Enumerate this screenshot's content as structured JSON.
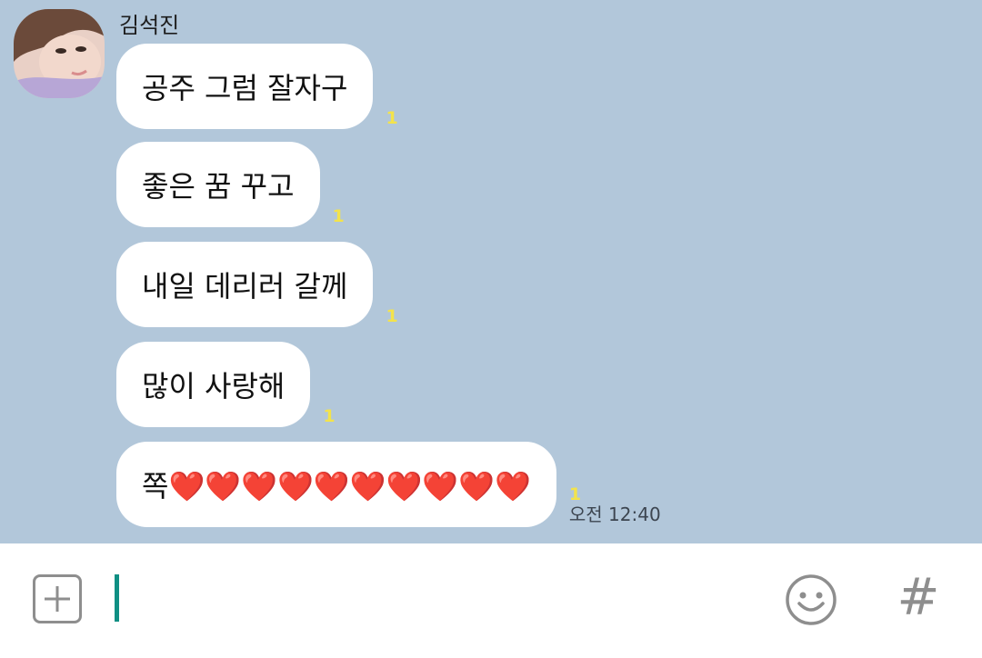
{
  "chat": {
    "sender_name": "김석진",
    "messages": [
      {
        "text": "공주 그럼 잘자구",
        "unread": "1"
      },
      {
        "text": "좋은 꿈 꾸고",
        "unread": "1"
      },
      {
        "text": "내일 데리러 갈께",
        "unread": "1"
      },
      {
        "text": "많이 사랑해",
        "unread": "1"
      },
      {
        "text": "쪽❤️❤️❤️❤️❤️❤️❤️❤️❤️❤️",
        "unread": "1",
        "time": "오전 12:40"
      }
    ]
  },
  "input_bar": {
    "message_value": "",
    "plus_icon": "plus-icon",
    "emoji_icon": "smiley-face-icon",
    "hash_label": "#"
  },
  "colors": {
    "chat_background": "#b2c7da",
    "bubble": "#ffffff",
    "unread_count": "#f3e34b",
    "caret": "#0f8f83",
    "icon_gray": "#8e8e8e"
  }
}
